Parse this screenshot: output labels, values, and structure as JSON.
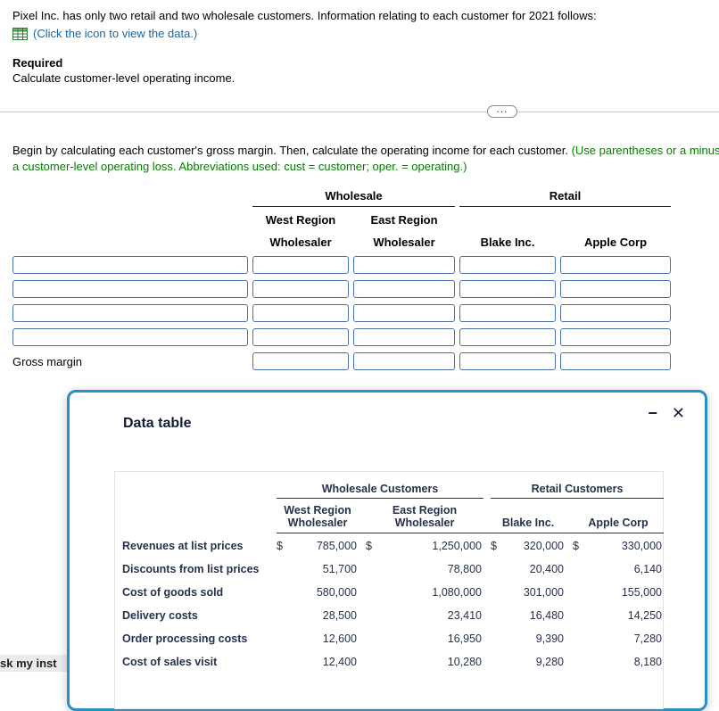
{
  "colors": {
    "link_blue": "#1266a9",
    "hint_green": "#077d00",
    "modal_border": "#2a8fc7",
    "input_border": "#4a72a8"
  },
  "page": {
    "intro": "Pixel Inc. has only two retail and two wholesale customers. Information relating to each customer for 2021 follows:",
    "data_link": "(Click the icon to view the data.)",
    "required_label": "Required",
    "required_text": "Calculate customer-level operating income.",
    "ellipsis": "...",
    "instruction_main": "Begin by calculating each customer's gross margin. Then, calculate the operating income for each customer. ",
    "instruction_hint_line1": "(Use parentheses or a minus",
    "instruction_hint_line2": "a customer-level operating loss. Abbreviations used: cust = customer; oper. = operating.)"
  },
  "answer_table": {
    "group_headers": [
      "Wholesale",
      "Retail"
    ],
    "columns": [
      {
        "region": "West Region",
        "name": "Wholesaler"
      },
      {
        "region": "East Region",
        "name": "Wholesaler"
      },
      {
        "region": "",
        "name": "Blake Inc."
      },
      {
        "region": "",
        "name": "Apple Corp"
      }
    ],
    "gross_margin_label": "Gross margin"
  },
  "modal": {
    "title": "Data table",
    "minimize_icon": "−",
    "close_icon": "✕",
    "table": {
      "group_headers": [
        "Wholesale Customers",
        "Retail Customers"
      ],
      "columns": [
        {
          "region": "West Region",
          "name": "Wholesaler"
        },
        {
          "region": "East Region",
          "name": "Wholesaler"
        },
        {
          "region": "",
          "name": "Blake Inc."
        },
        {
          "region": "",
          "name": "Apple Corp"
        }
      ],
      "currency": "$",
      "rows": [
        {
          "label": "Revenues at list prices",
          "values": [
            "785,000",
            "1,250,000",
            "320,000",
            "330,000"
          ]
        },
        {
          "label": "Discounts from list prices",
          "values": [
            "51,700",
            "78,800",
            "20,400",
            "6,140"
          ]
        },
        {
          "label": "Cost of goods sold",
          "values": [
            "580,000",
            "1,080,000",
            "301,000",
            "155,000"
          ]
        },
        {
          "label": "Delivery costs",
          "values": [
            "28,500",
            "23,410",
            "16,480",
            "14,250"
          ]
        },
        {
          "label": "Order processing costs",
          "values": [
            "12,600",
            "16,950",
            "9,390",
            "7,280"
          ]
        },
        {
          "label": "Cost of sales visit",
          "values": [
            "12,400",
            "10,280",
            "9,280",
            "8,180"
          ]
        }
      ]
    }
  },
  "footer": {
    "partial_text": "sk my inst"
  }
}
